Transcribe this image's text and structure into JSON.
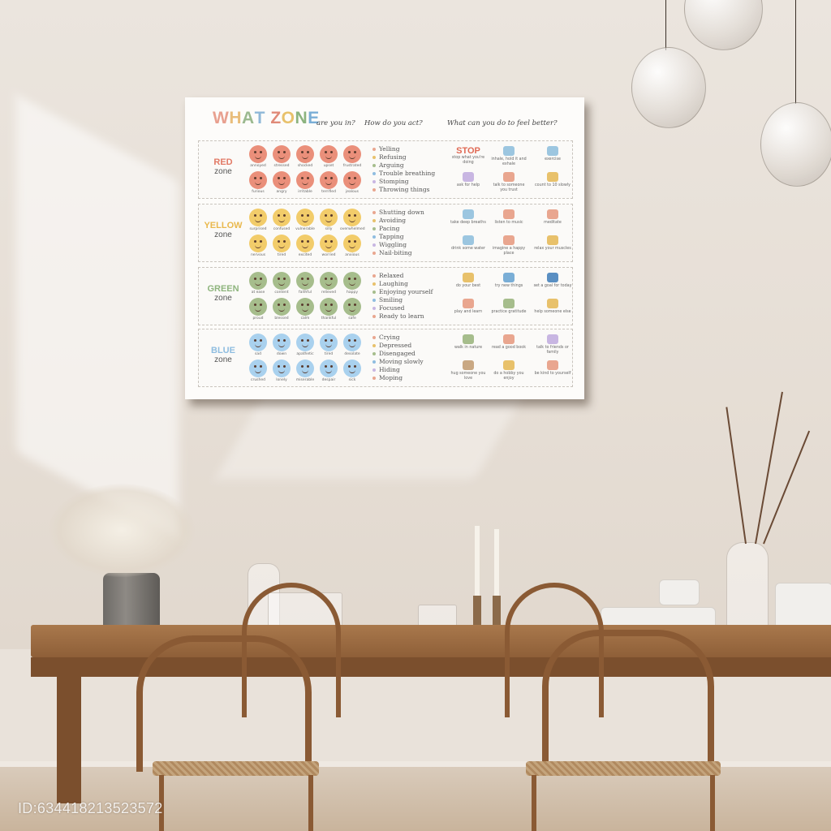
{
  "poster": {
    "title_letters": [
      {
        "ch": "W",
        "color": "#e8a08f"
      },
      {
        "ch": "H",
        "color": "#e9bd7a"
      },
      {
        "ch": "A",
        "color": "#9bb98f"
      },
      {
        "ch": "T",
        "color": "#8fb8d8"
      },
      {
        "ch": " ",
        "color": "#000"
      },
      {
        "ch": "Z",
        "color": "#e08a78"
      },
      {
        "ch": "O",
        "color": "#e8c16b"
      },
      {
        "ch": "N",
        "color": "#8cb37e"
      },
      {
        "ch": "E",
        "color": "#7aaed6"
      }
    ],
    "headers": {
      "zone_q": "are you in?",
      "act_q": "How do you act?",
      "better_q": "What can you do to feel better?"
    },
    "zones": [
      {
        "name": "RED",
        "sub": "zone",
        "name_color": "#e27a66",
        "face_color": "#ea8f7a",
        "faces_top": [
          "annoyed",
          "stressed",
          "shocked",
          "upset",
          "frustrated"
        ],
        "faces_bottom": [
          "furious",
          "angry",
          "irritable",
          "terrified",
          "jealous"
        ],
        "actions": [
          "Yelling",
          "Refusing",
          "Arguing",
          "Trouble breathing",
          "Stomping",
          "Throwing things"
        ],
        "tips": [
          {
            "label": "STOP",
            "text": "stop what you're doing",
            "icon": "stop-text"
          },
          {
            "text": "inhale, hold it and exhale",
            "icon": "lungs-icon",
            "color": "#9cc6e0"
          },
          {
            "text": "exercise",
            "icon": "dumbbell-icon",
            "color": "#9cc6e0"
          },
          {
            "text": "ask for help",
            "icon": "speech-bubble-icon",
            "color": "#c8b6e2"
          },
          {
            "text": "talk to someone you trust",
            "icon": "people-icon",
            "color": "#e9a68f"
          },
          {
            "text": "count to 10 slowly",
            "icon": "numbers-icon",
            "color": "#e8c16b"
          }
        ]
      },
      {
        "name": "YELLOW",
        "sub": "zone",
        "name_color": "#e9b84d",
        "face_color": "#f2cc6a",
        "faces_top": [
          "surprised",
          "confused",
          "vulnerable",
          "silly",
          "overwhelmed"
        ],
        "faces_bottom": [
          "nervous",
          "tired",
          "excited",
          "worried",
          "anxious"
        ],
        "actions": [
          "Shutting down",
          "Avoiding",
          "Pacing",
          "Tapping",
          "Wiggling",
          "Nail-biting"
        ],
        "tips": [
          {
            "text": "take deep breaths",
            "icon": "spiral-icon",
            "color": "#9cc6e0"
          },
          {
            "text": "listen to music",
            "icon": "headphones-icon",
            "color": "#e9a68f"
          },
          {
            "text": "meditate",
            "icon": "brain-icon",
            "color": "#e9a68f"
          },
          {
            "text": "drink some water",
            "icon": "water-glass-icon",
            "color": "#9cc6e0"
          },
          {
            "text": "imagine a happy place",
            "icon": "rainbow-icon",
            "color": "#e9a68f"
          },
          {
            "text": "relax your muscles",
            "icon": "muscle-icon",
            "color": "#e8c16b"
          }
        ]
      },
      {
        "name": "GREEN",
        "sub": "zone",
        "name_color": "#8fb57e",
        "face_color": "#a6bd8c",
        "faces_top": [
          "at ease",
          "content",
          "faithful",
          "relieved",
          "happy"
        ],
        "faces_bottom": [
          "proud",
          "blessed",
          "calm",
          "thankful",
          "safe"
        ],
        "actions": [
          "Relaxed",
          "Laughing",
          "Enjoying yourself",
          "Smiling",
          "Focused",
          "Ready to learn"
        ],
        "tips": [
          {
            "text": "do your best",
            "icon": "lightning-icon",
            "color": "#e8c16b"
          },
          {
            "text": "try new things",
            "icon": "skateboard-icon",
            "color": "#7aaed6"
          },
          {
            "text": "set a goal for today",
            "icon": "check-icon",
            "color": "#5a8fc2"
          },
          {
            "text": "play and learn",
            "icon": "ticket-icon",
            "color": "#e9a68f"
          },
          {
            "text": "practice gratitude",
            "icon": "smile-icon",
            "color": "#a6bd8c"
          },
          {
            "text": "help someone else",
            "icon": "sun-icon",
            "color": "#e8c16b"
          }
        ]
      },
      {
        "name": "BLUE",
        "sub": "zone",
        "name_color": "#8fbde0",
        "face_color": "#a9d1ee",
        "faces_top": [
          "sad",
          "down",
          "apathetic",
          "tired",
          "desolate"
        ],
        "faces_bottom": [
          "crushed",
          "lonely",
          "miserable",
          "despair",
          "sick"
        ],
        "actions": [
          "Crying",
          "Depressed",
          "Disengaged",
          "Moving slowly",
          "Hiding",
          "Moping"
        ],
        "tips": [
          {
            "text": "walk in nature",
            "icon": "tree-icon",
            "color": "#a6bd8c"
          },
          {
            "text": "read a good book",
            "icon": "books-icon",
            "color": "#e9a68f"
          },
          {
            "text": "talk to friends or family",
            "icon": "chat-icon",
            "color": "#c8b6e2"
          },
          {
            "text": "hug someone you love",
            "icon": "dog-icon",
            "color": "#c9a883"
          },
          {
            "text": "do a hobby you enjoy",
            "icon": "paint-icon",
            "color": "#e8c16b"
          },
          {
            "text": "be kind to yourself",
            "icon": "heart-icon",
            "color": "#e9a68f"
          }
        ]
      }
    ]
  },
  "watermark": "ID:634418213523572"
}
